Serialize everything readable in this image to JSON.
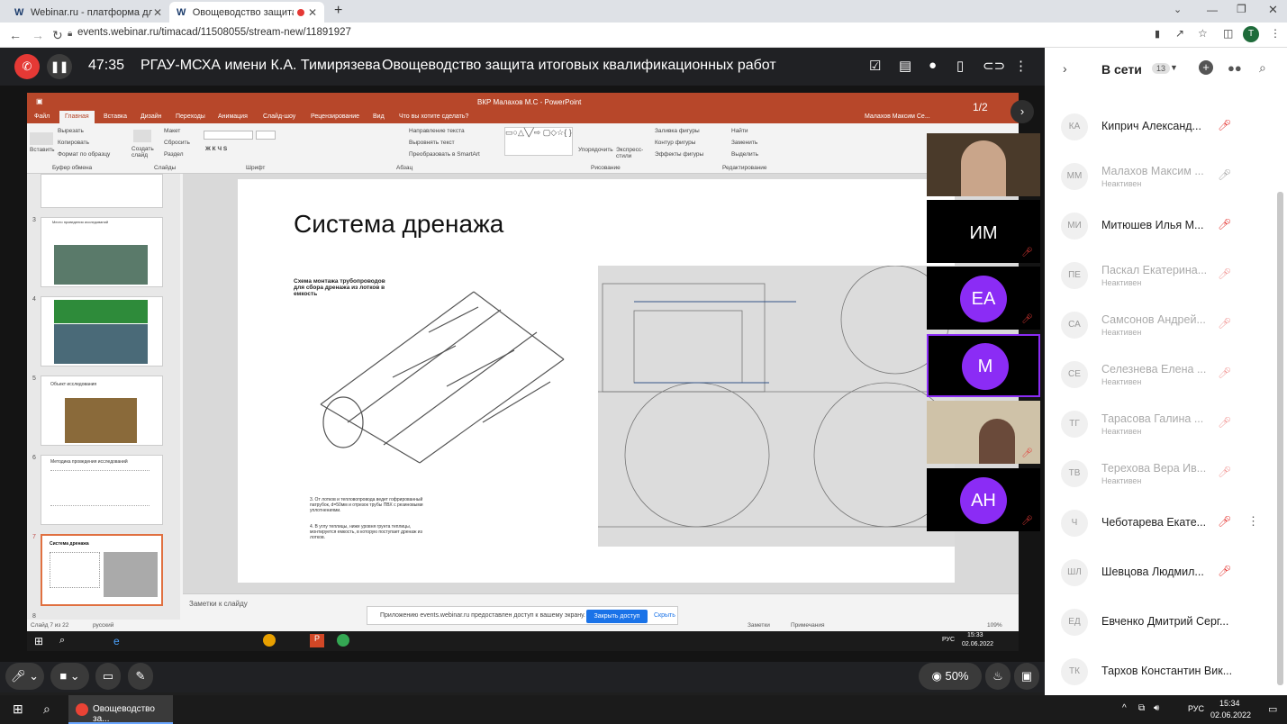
{
  "browser": {
    "tabs": [
      {
        "favicon": "W",
        "title": "Webinar.ru - платформа для пр..."
      },
      {
        "favicon": "W",
        "title": "Овощеводство защита итог..."
      }
    ],
    "new_tab": "+",
    "url": "events.webinar.ru/timacad/11508055/stream-new/11891927",
    "profile_initial": "T"
  },
  "webinar": {
    "timer": "47:35",
    "organization": "РГАУ-МСХА имени К.А. Тимирязева",
    "event_title": "Овощеводство защита итоговых квалификационных работ",
    "pager": "1/2"
  },
  "ppt": {
    "window_title": "ВКР Малахов М.С - PowerPoint",
    "user": "Малахов Максим Се...",
    "menu": [
      "Файл",
      "Главная",
      "Вставка",
      "Дизайн",
      "Переходы",
      "Анимация",
      "Слайд-шоу",
      "Рецензирование",
      "Вид"
    ],
    "tell_me": "Что вы хотите сделать?",
    "ribbon": {
      "paste": "Вставить",
      "cut": "Вырезать",
      "copy": "Копировать",
      "format_painter": "Формат по образцу",
      "clipboard_group": "Буфер обмена",
      "new_slide": "Создать слайд",
      "layout": "Макет",
      "reset": "Сбросить",
      "section": "Раздел",
      "slides_group": "Слайды",
      "font_group": "Шрифт",
      "text_direction": "Направление текста",
      "align_text": "Выровнять текст",
      "smartart": "Преобразовать в SmartArt",
      "paragraph_group": "Абзац",
      "arrange": "Упорядочить",
      "quick_styles": "Экспресс-стили",
      "shape_fill": "Заливка фигуры",
      "shape_outline": "Контур фигуры",
      "shape_effects": "Эффекты фигуры",
      "drawing_group": "Рисование",
      "find": "Найти",
      "replace": "Заменить",
      "select": "Выделить",
      "editing_group": "Редактирование"
    },
    "thumbnails": [
      {
        "num": "3",
        "title": "Место проведения исследований"
      },
      {
        "num": "4",
        "title": ""
      },
      {
        "num": "5",
        "title": "Объект исследования"
      },
      {
        "num": "6",
        "title": "Методика проведения исследований"
      },
      {
        "num": "7",
        "title": "Система дренажа"
      },
      {
        "num": "8",
        "title": ""
      }
    ],
    "slide_title": "Система дренажа",
    "scheme_title": "Схема монтажа трубопроводов для сбора дренажа из лотков в емкость",
    "scheme_notes": [
      "3. От лотков и тепловопроводa ведет гофрированный патрубок, d=50мм и отрезок трубы ПВХ с резиновыми уплотнениями.",
      "4. В углу теплицы, ниже уровня грунта теплицы, монтируется емкость, в которую поступает дренаж из лотков."
    ],
    "notes_placeholder": "Заметки к слайду",
    "status_slide": "Слайд 7 из 22",
    "status_lang": "русский",
    "status_notes": "Заметки",
    "status_comments": "Примечания",
    "zoom": "109%"
  },
  "share_bar": {
    "message": "Приложению events.webinar.ru предоставлен доступ к вашему экрану.",
    "stop": "Закрыть доступ",
    "hide": "Скрыть"
  },
  "remote_tray": {
    "lang": "РУС",
    "time": "15:33",
    "date": "02.06.2022"
  },
  "video_tiles": [
    {
      "type": "camera"
    },
    {
      "type": "initials",
      "text": "ИМ"
    },
    {
      "type": "avatar",
      "text": "ЕА"
    },
    {
      "type": "avatar",
      "text": "М"
    },
    {
      "type": "camera"
    },
    {
      "type": "avatar",
      "text": "АН"
    }
  ],
  "controls": {
    "view_percent": "50%"
  },
  "sidebar": {
    "title": "В сети",
    "count": "13",
    "participants": [
      {
        "initials": "КА",
        "name": "Киприч Александ...",
        "status": ""
      },
      {
        "initials": "ММ",
        "name": "Малахов Максим ...",
        "status": "Неактивен"
      },
      {
        "initials": "МИ",
        "name": "Митюшев Илья М...",
        "status": ""
      },
      {
        "initials": "ПЕ",
        "name": "Паскал Екатерина...",
        "status": "Неактивен"
      },
      {
        "initials": "СА",
        "name": "Самсонов Андрей...",
        "status": "Неактивен"
      },
      {
        "initials": "СЕ",
        "name": "Селезнева Елена ...",
        "status": "Неактивен"
      },
      {
        "initials": "ТГ",
        "name": "Тарасова Галина ...",
        "status": "Неактивен"
      },
      {
        "initials": "ТВ",
        "name": "Терехова Вера Ив...",
        "status": "Неактивен"
      },
      {
        "initials": "Ч",
        "name": "Чеботарева Екате...",
        "status": ""
      },
      {
        "initials": "ШЛ",
        "name": "Шевцова Людмил...",
        "status": ""
      },
      {
        "initials": "ЕД",
        "name": "Евченко Дмитрий Серг...",
        "status": ""
      },
      {
        "initials": "ТК",
        "name": "Тархов Константин Вик...",
        "status": ""
      }
    ]
  },
  "taskbar": {
    "app_title": "Овощеводство за...",
    "lang": "РУС",
    "time": "15:34",
    "date": "02.06.2022"
  },
  "colors": {
    "accent_purple": "#8b2cf5",
    "danger": "#e53935",
    "ppt_orange": "#b7472a",
    "active_blue": "#1a73e8"
  }
}
